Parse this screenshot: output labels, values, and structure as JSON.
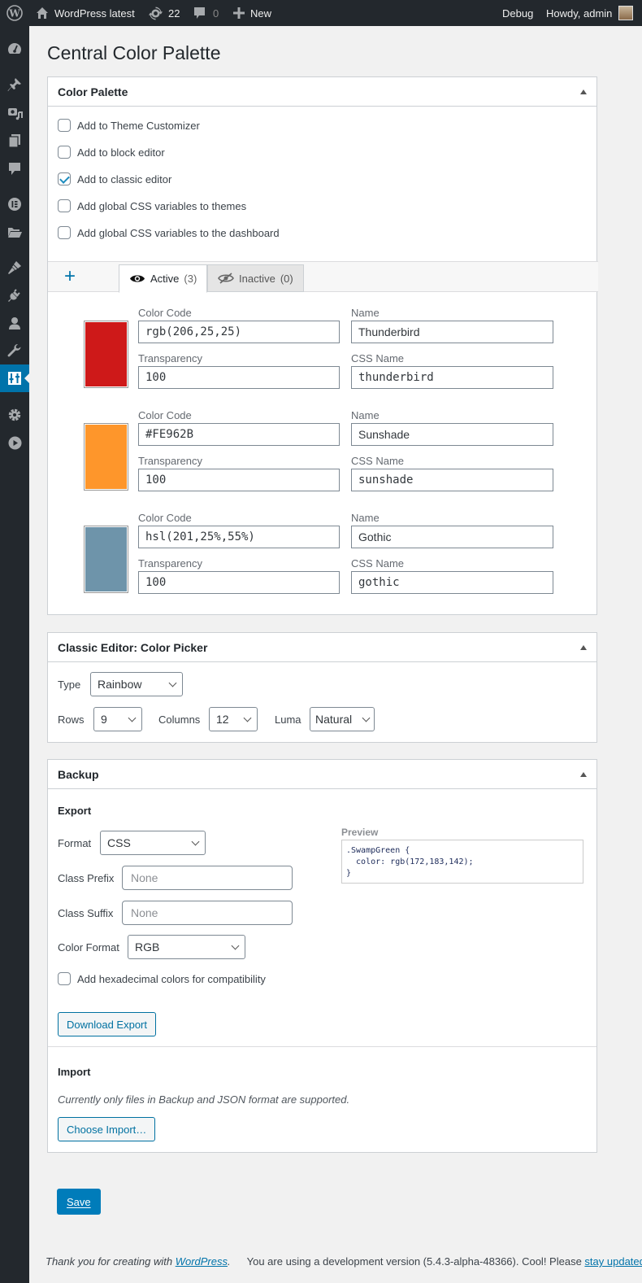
{
  "adminbar": {
    "site_name": "WordPress latest",
    "updates_count": "22",
    "comments_count": "0",
    "new_label": "New",
    "debug_label": "Debug",
    "howdy_label": "Howdy, admin"
  },
  "sidebar": {
    "items": [
      {
        "icon": "dashboard-icon"
      },
      {
        "icon": "pin-icon"
      },
      {
        "icon": "media-icon"
      },
      {
        "icon": "pages-icon"
      },
      {
        "icon": "comments-icon"
      },
      {
        "icon": "elementor-icon"
      },
      {
        "icon": "folder-icon"
      },
      {
        "icon": "appearance-icon"
      },
      {
        "icon": "plugins-icon"
      },
      {
        "icon": "users-icon"
      },
      {
        "icon": "tools-icon"
      },
      {
        "icon": "color-palette-icon",
        "active": true
      },
      {
        "icon": "settings-icon"
      },
      {
        "icon": "play-icon"
      }
    ]
  },
  "page": {
    "title": "Central Color Palette"
  },
  "palette_box": {
    "title": "Color Palette",
    "options": [
      {
        "label": "Add to Theme Customizer",
        "checked": false
      },
      {
        "label": "Add to block editor",
        "checked": false
      },
      {
        "label": "Add to classic editor",
        "checked": true
      },
      {
        "label": "Add global CSS variables to themes",
        "checked": false
      },
      {
        "label": "Add global CSS variables to the dashboard",
        "checked": false
      }
    ],
    "add_label": "+",
    "tabs": [
      {
        "label": "Active",
        "count": "(3)"
      },
      {
        "label": "Inactive",
        "count": "(0)"
      }
    ],
    "field_labels": {
      "color_code": "Color Code",
      "name": "Name",
      "transparency": "Transparency",
      "css_name": "CSS Name"
    },
    "colors": [
      {
        "swatch": "#ce1919",
        "code": "rgb(206,25,25)",
        "name": "Thunderbird",
        "transparency": "100",
        "css_name": "thunderbird"
      },
      {
        "swatch": "#fe962b",
        "code": "#FE962B",
        "name": "Sunshade",
        "transparency": "100",
        "css_name": "sunshade"
      },
      {
        "swatch": "#6e94aa",
        "code": "hsl(201,25%,55%)",
        "name": "Gothic",
        "transparency": "100",
        "css_name": "gothic"
      }
    ]
  },
  "picker_box": {
    "title": "Classic Editor: Color Picker",
    "type_label": "Type",
    "type_value": "Rainbow",
    "rows_label": "Rows",
    "rows_value": "9",
    "columns_label": "Columns",
    "columns_value": "12",
    "luma_label": "Luma",
    "luma_value": "Natural"
  },
  "backup_box": {
    "title": "Backup",
    "export_heading": "Export",
    "format_label": "Format",
    "format_value": "CSS",
    "prefix_label": "Class Prefix",
    "prefix_placeholder": "None",
    "suffix_label": "Class Suffix",
    "suffix_placeholder": "None",
    "color_format_label": "Color Format",
    "color_format_value": "RGB",
    "hex_label": "Add hexadecimal colors for compatibility",
    "preview_label": "Preview",
    "preview_code": ".SwampGreen {\n  color: rgb(172,183,142);\n}",
    "download_label": "Download Export",
    "import_heading": "Import",
    "import_note": "Currently only files in Backup and JSON format are supported.",
    "choose_label": "Choose Import…"
  },
  "save_label": "Save",
  "footer": {
    "thanks_prefix": "Thank you for creating with ",
    "wordpress_link": "WordPress",
    "version_text": "You are using a development version (5.4.3-alpha-48366). Cool! Please ",
    "stay_updated_link": "stay updated"
  }
}
